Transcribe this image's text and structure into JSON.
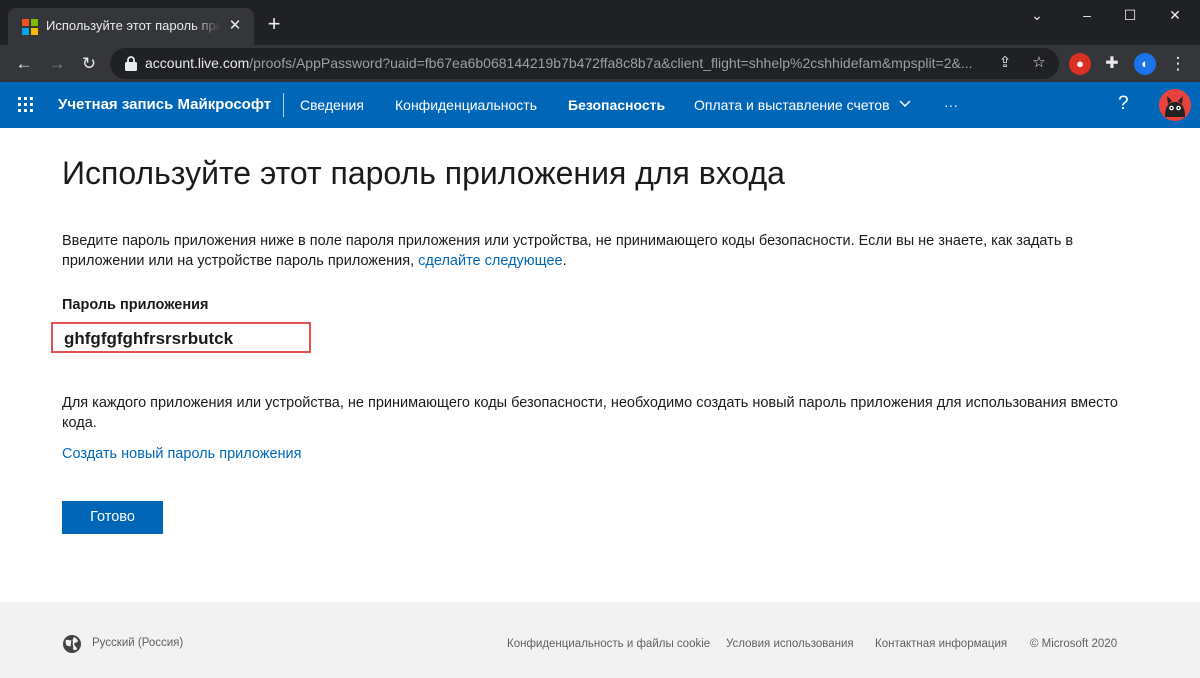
{
  "browser": {
    "tab_title": "Используйте этот пароль приложения",
    "tab_close": "✕",
    "new_tab": "+",
    "url_host": "account.live.com",
    "url_path": "/proofs/AppPassword?uaid=fb67ea6b068144219b7b472ffa8c8b7a&client_flight=shhelp%2cshhidefam&mpsplit=2&..."
  },
  "nav": {
    "brand": "Учетная запись Майкрософт",
    "items": [
      {
        "label": "Сведения"
      },
      {
        "label": "Конфиденциальность"
      },
      {
        "label": "Безопасность"
      },
      {
        "label": "Оплата и выставление счетов"
      }
    ],
    "more": "···",
    "help": "?"
  },
  "main": {
    "title": "Используйте этот пароль приложения для входа",
    "intro": "Введите пароль приложения ниже в поле пароля приложения или устройства, не принимающего коды безопасности. Если вы не знаете, как задать в приложении или на устройстве пароль приложения, ",
    "intro_link": "сделайте следующее",
    "intro_end": ".",
    "field_label": "Пароль приложения",
    "password": "ghfgfgfghfrsrsrbutck",
    "note": "Для каждого приложения или устройства, не принимающего коды безопасности, необходимо создать новый пароль приложения для использования вместо кода.",
    "create_link": "Создать новый пароль приложения",
    "done_button": "Готово"
  },
  "footer": {
    "language": "Русский (Россия)",
    "links": [
      "Конфиденциальность и файлы cookie",
      "Условия использования",
      "Контактная информация",
      "© Microsoft 2020"
    ]
  },
  "colors": {
    "brand_blue": "#0067b8",
    "highlight_red": "#e25252"
  }
}
